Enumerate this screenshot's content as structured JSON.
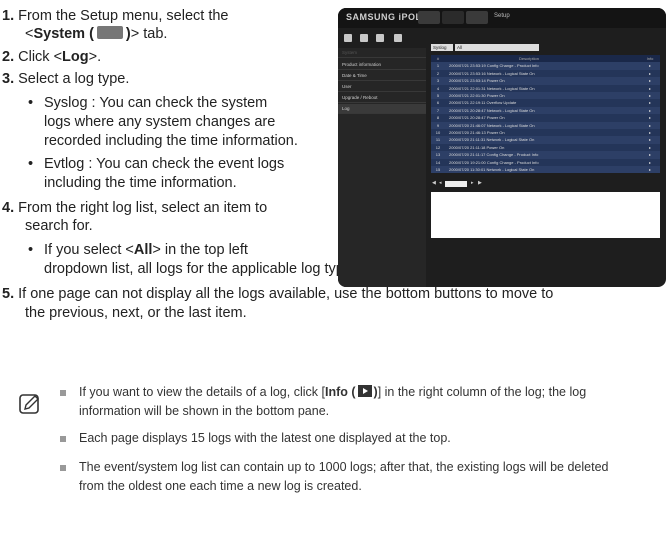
{
  "steps": {
    "s1_num": "1.",
    "s1_pre": "From the Setup menu, select the",
    "s1_line2_pre": "<",
    "s1_system": "System (",
    "s1_system_close": ")",
    "s1_line2_post": "> tab.",
    "s2_num": "2.",
    "s2_pre": "Click <",
    "s2_log": "Log",
    "s2_post": ">.",
    "s3_num": "3.",
    "s3_text": "Select a log type.",
    "b_syslog_1": "Syslog : You can check the system",
    "b_syslog_2": "logs where any system changes are",
    "b_syslog_3": "recorded including the time information.",
    "b_evtlog_1": "Evtlog : You can check the event logs",
    "b_evtlog_2": "including the time information.",
    "s4_num": "4.",
    "s4_line1": "From the right log list, select an item to",
    "s4_line2": "search for.",
    "b_all_1_pre": "If you select <",
    "b_all_bold": "All",
    "b_all_1_post": "> in the top left",
    "b_all_2": "dropdown list, all logs for the applicable log type will be displayed.",
    "s5_num": "5.",
    "s5_line1": "If one page can not display all the logs available, use the bottom buttons to move to",
    "s5_line2": "the previous, next, or the last item."
  },
  "notes": {
    "n1_pre": "If you want to view the details of a log, click [",
    "n1_info": "Info (",
    "n1_close": ")",
    "n1_post": "] in the right column of the log; the log",
    "n1_line2": "information will be shown in the bottom pane.",
    "n2": "Each page displays 15 logs with the latest one displayed at the top.",
    "n3_line1": "The event/system log list can contain up to 1000 logs; after that, the existing logs will be deleted",
    "n3_line2": "from the oldest one each time a new log is created."
  },
  "screenshot": {
    "logo": "SAMSUNG iPOLiS",
    "setup_label": "Setup",
    "sidebar_header": "System",
    "sidebar_items": [
      "Product information",
      "Date & Time",
      "User",
      "Upgrade / Reboot",
      "Log"
    ],
    "log_type": "Syslog",
    "filter": "All",
    "col_num": "#",
    "col_desc": "Description",
    "col_info": "Info",
    "rows": [
      {
        "n": "1",
        "d": "2000/07/21 23:53:19 Config Change - Product Info"
      },
      {
        "n": "2",
        "d": "2000/07/21 23:53:16 Network - Logical State On"
      },
      {
        "n": "3",
        "d": "2000/07/21 23:53:14 Power On"
      },
      {
        "n": "4",
        "d": "2000/07/21 22:01:31 Network - Logical State On"
      },
      {
        "n": "5",
        "d": "2000/07/21 22:01:30 Power On"
      },
      {
        "n": "6",
        "d": "2000/07/21 22:19:11 Overflow Update"
      },
      {
        "n": "7",
        "d": "2000/07/21 20:28:47 Network - Logical State On"
      },
      {
        "n": "8",
        "d": "2000/07/21 20:28:47 Power On"
      },
      {
        "n": "9",
        "d": "2000/07/20 21:46:07 Network - Logical State On"
      },
      {
        "n": "10",
        "d": "2000/07/20 21:46:13 Power On"
      },
      {
        "n": "11",
        "d": "2000/07/20 21:11:31 Network - Logical State On"
      },
      {
        "n": "12",
        "d": "2000/07/20 21:11:18 Power On"
      },
      {
        "n": "13",
        "d": "2000/07/20 21:11:17 Config Change - Product Info"
      },
      {
        "n": "14",
        "d": "2000/07/20 19:21:00 Config Change - Product Info"
      },
      {
        "n": "15",
        "d": "2000/07/20 11:30:01 Network - Logical State On"
      }
    ]
  }
}
